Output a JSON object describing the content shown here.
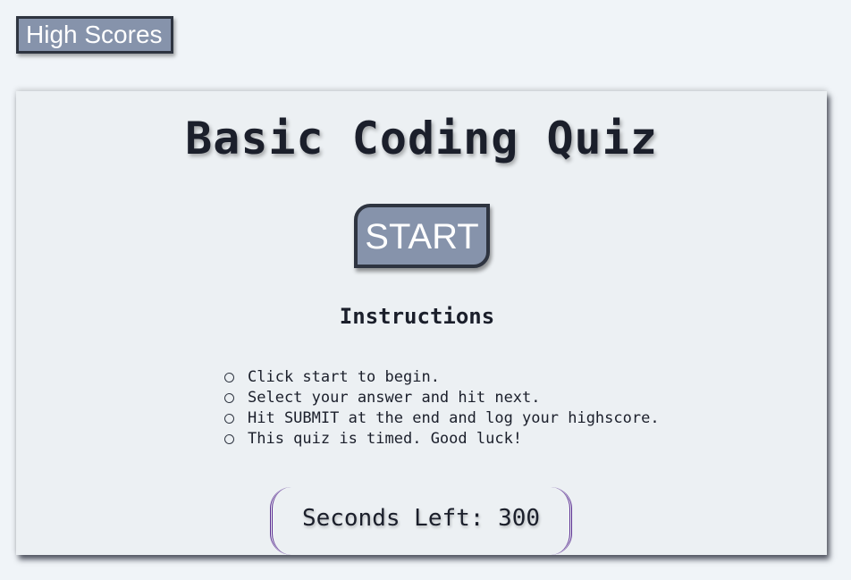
{
  "header": {
    "high_scores_label": "High Scores"
  },
  "quiz": {
    "title": "Basic Coding Quiz",
    "start_label": "START",
    "instructions_heading": "Instructions",
    "instructions": [
      "Click start to begin.",
      "Select your answer and hit next.",
      "Hit SUBMIT at the end and log your highscore.",
      "This quiz is timed. Good luck!"
    ],
    "timer_label": "Seconds Left: ",
    "timer_value": "300"
  },
  "colors": {
    "page_background": "#f0f4f8",
    "card_background": "#ecf0f3",
    "button_fill": "#8693ab",
    "button_border": "#2e3440",
    "text_dark": "#1b1f2b",
    "timer_border": "#5a2d91"
  }
}
